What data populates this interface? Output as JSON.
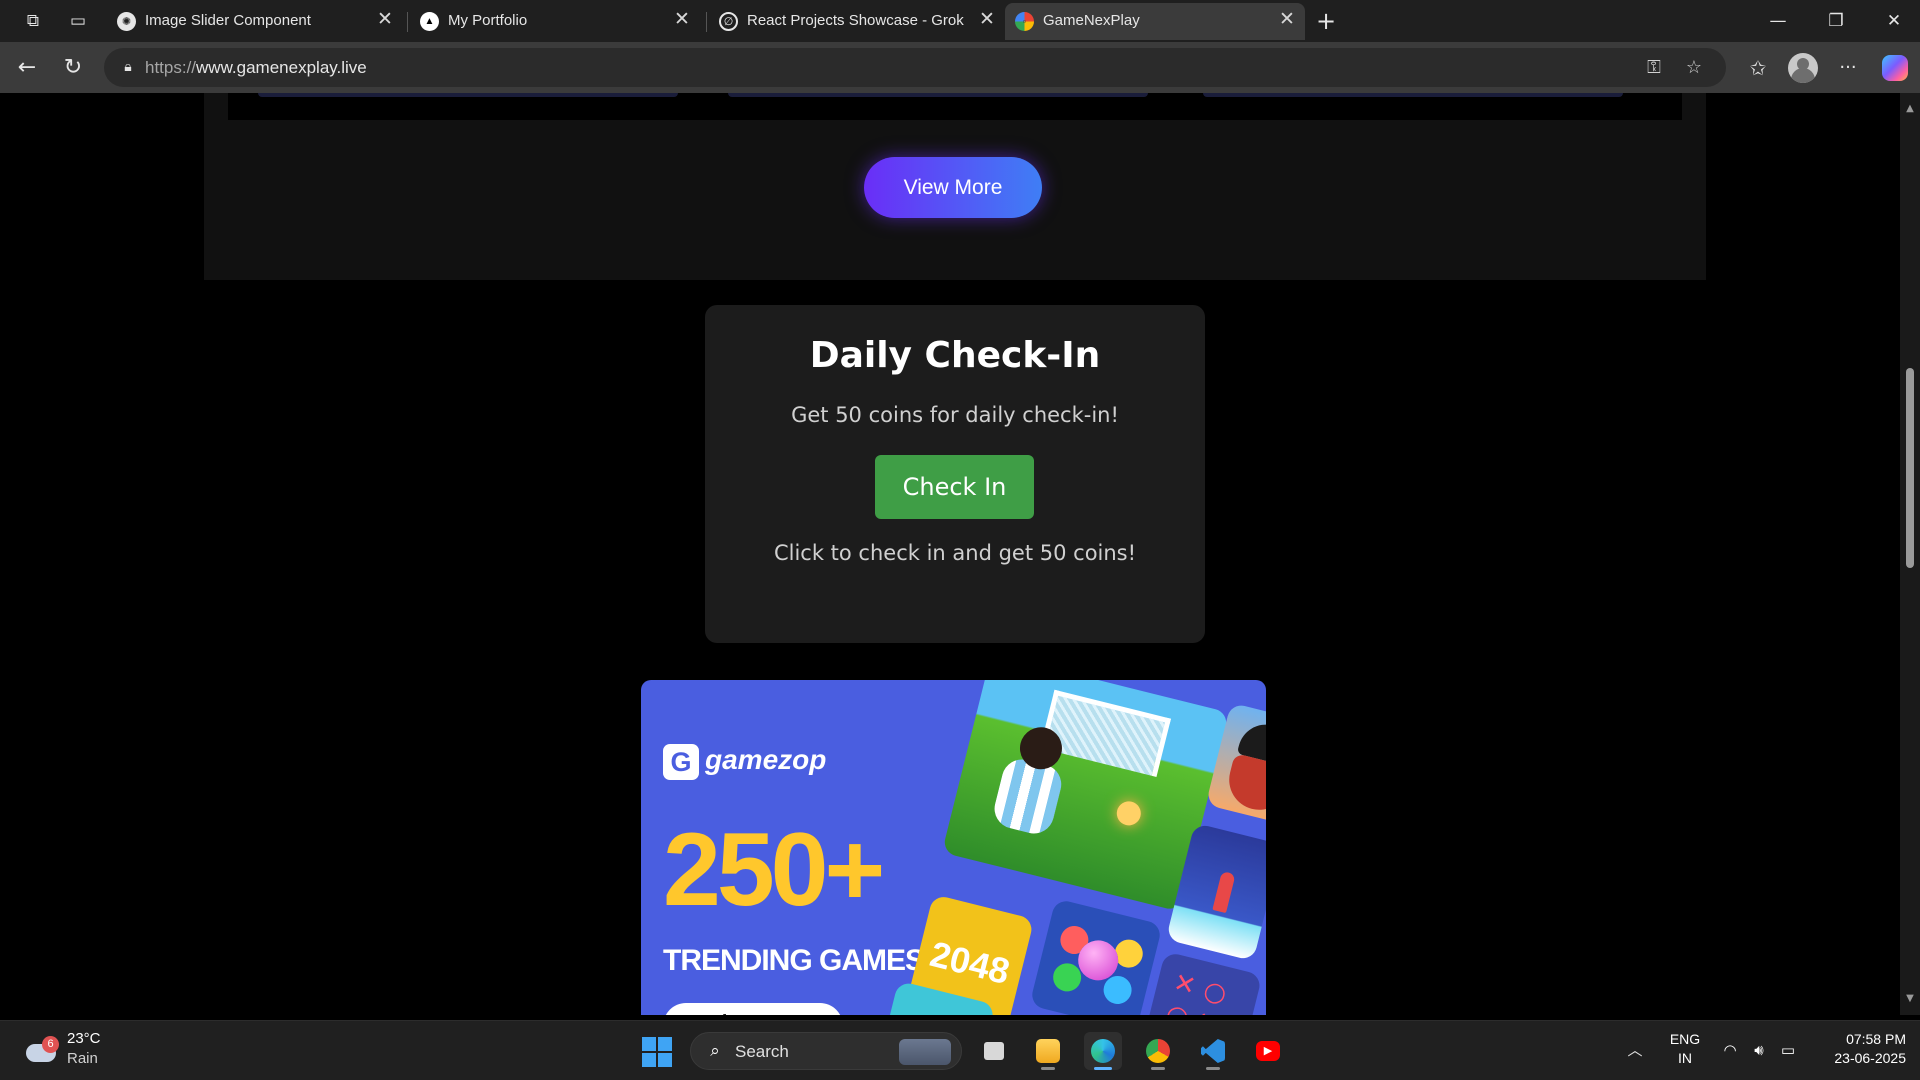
{
  "browser": {
    "tabs": [
      {
        "title": "Image Slider Component",
        "favicon": "openai-icon",
        "active": false
      },
      {
        "title": "My Portfolio",
        "favicon": "vercel-icon",
        "active": false
      },
      {
        "title": "React Projects Showcase - Grok",
        "favicon": "grok-icon",
        "active": false
      },
      {
        "title": "GameNexPlay",
        "favicon": "gamenexplay-icon",
        "active": true
      }
    ],
    "url_protocol": "https://",
    "url_host": "www.gamenexplay.live",
    "new_tab_glyph": "+",
    "close_glyph": "✕"
  },
  "page": {
    "view_more_label": "View More",
    "checkin": {
      "title": "Daily Check-In",
      "description": "Get 50 coins for daily check-in!",
      "button_label": "Check In",
      "hint": "Click to check in and get 50 coins!"
    },
    "ad": {
      "brand": "gamezop",
      "logo_letter": "G",
      "count": "250+",
      "tagline": "TRENDING GAMES!",
      "cta": "Play Now",
      "tile_2048": "2048"
    }
  },
  "taskbar": {
    "weather_temp": "23°C",
    "weather_desc": "Rain",
    "weather_badge": "6",
    "search_label": "Search",
    "lang_line1": "ENG",
    "lang_line2": "IN",
    "time": "07:58 PM",
    "date": "23-06-2025",
    "apps": [
      "task-view",
      "file-explorer",
      "edge",
      "chrome",
      "vs-code",
      "youtube"
    ]
  },
  "colors": {
    "accent_purple": "#6a2ef7",
    "accent_blue": "#3f7ef5",
    "checkin_green": "#3f9e46",
    "ad_blue": "#4a5ee0",
    "ad_yellow": "#ffc72c"
  }
}
